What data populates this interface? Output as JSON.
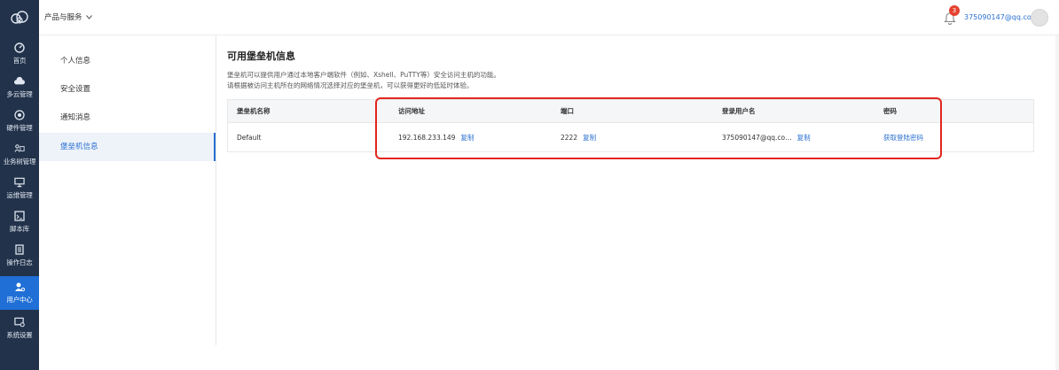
{
  "topbar": {
    "product_menu": "产品与服务",
    "notification_count": "3",
    "user_email": "375090147@qq.com"
  },
  "nav": {
    "items": [
      {
        "label": "首页",
        "icon": "dashboard-icon"
      },
      {
        "label": "多云管理",
        "icon": "cloud-icon"
      },
      {
        "label": "硬件管理",
        "icon": "hardware-icon"
      },
      {
        "label": "业务树管理",
        "icon": "business-tree-icon"
      },
      {
        "label": "运维管理",
        "icon": "monitor-icon"
      },
      {
        "label": "脚本库",
        "icon": "script-icon"
      },
      {
        "label": "操作日志",
        "icon": "log-icon"
      },
      {
        "label": "用户中心",
        "icon": "user-center-icon",
        "active": true
      },
      {
        "label": "系统设置",
        "icon": "settings-icon"
      }
    ],
    "accent": "#1f6fd6"
  },
  "subnav": {
    "items": [
      {
        "label": "个人信息"
      },
      {
        "label": "安全设置"
      },
      {
        "label": "通知消息"
      },
      {
        "label": "堡垒机信息",
        "active": true
      }
    ]
  },
  "main": {
    "title": "可用堡垒机信息",
    "desc_line1": "堡垒机可以提供用户通过本地客户端软件（例如、Xshell、PuTTY等）安全访问主机的功能。",
    "desc_line2": "请根据被访问主机所在的网络情况选择对应的堡垒机，可以获得更好的低延时体验。",
    "table": {
      "headers": [
        "堡垒机名称",
        "访问地址",
        "端口",
        "登录用户名",
        "密码"
      ],
      "rows": [
        {
          "name": "Default",
          "address": "192.168.233.149",
          "port": "2222",
          "username": "375090147@qq.co…",
          "password_action": "获取登陆密码",
          "copy_label": "复制"
        }
      ]
    }
  }
}
